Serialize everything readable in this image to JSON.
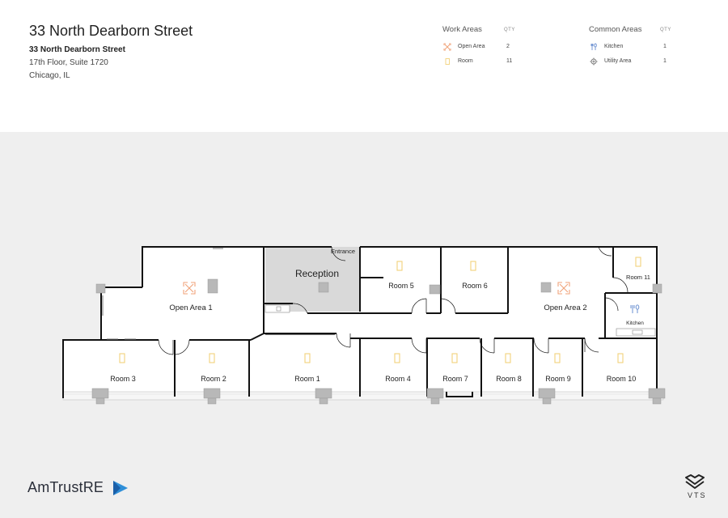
{
  "header": {
    "title": "33 North Dearborn Street",
    "address_line1": "33 North Dearborn Street",
    "address_line2": "17th Floor, Suite 1720",
    "address_line3": "Chicago, IL"
  },
  "legend": {
    "work_areas": {
      "heading": "Work Areas",
      "qty_label": "QTY",
      "items": [
        {
          "label": "Open Area",
          "qty": "2",
          "icon": "open-area-icon",
          "color": "#f0a37a"
        },
        {
          "label": "Room",
          "qty": "11",
          "icon": "room-icon",
          "color": "#f2d27a"
        }
      ]
    },
    "common_areas": {
      "heading": "Common Areas",
      "qty_label": "QTY",
      "items": [
        {
          "label": "Kitchen",
          "qty": "1",
          "icon": "kitchen-icon",
          "color": "#6a8fd0"
        },
        {
          "label": "Utility Area",
          "qty": "1",
          "icon": "gear-icon",
          "color": "#777777"
        }
      ]
    }
  },
  "plan": {
    "labels": {
      "open_area_1": "Open Area 1",
      "open_area_2": "Open Area 2",
      "reception": "Reception",
      "entrance": "Entrance",
      "kitchen": "Kitchen",
      "room_1": "Room 1",
      "room_2": "Room 2",
      "room_3": "Room 3",
      "room_4": "Room 4",
      "room_5": "Room 5",
      "room_6": "Room 6",
      "room_7": "Room 7",
      "room_8": "Room 8",
      "room_9": "Room 9",
      "room_10": "Room 10",
      "room_11": "Room 11"
    },
    "colors": {
      "wall": "#111111",
      "floor": "#ffffff",
      "reception_floor": "#d9d9d9",
      "column": "#b5b5b5",
      "room_icon": "#f2d27a",
      "open_icon": "#f0a37a",
      "kitchen_icon": "#6a8fd0"
    }
  },
  "footer": {
    "brand_left": "AmTrust",
    "brand_left_suffix": "RE",
    "brand_right": "VTS"
  }
}
